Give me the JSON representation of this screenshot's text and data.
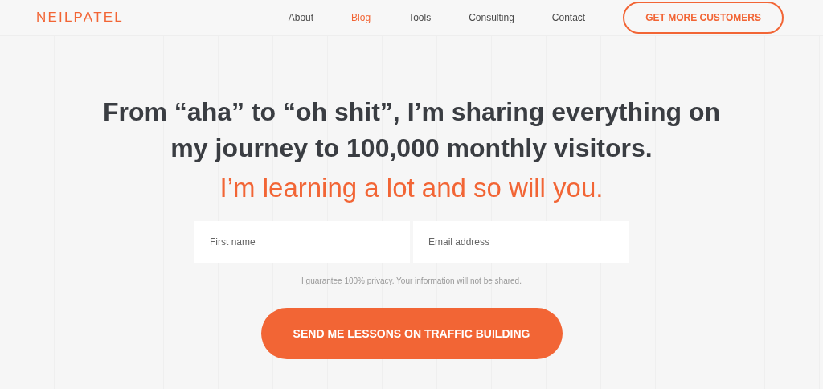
{
  "header": {
    "logo": "NEILPATEL",
    "nav": [
      {
        "label": "About",
        "selected": false
      },
      {
        "label": "Blog",
        "selected": true
      },
      {
        "label": "Tools",
        "selected": false
      },
      {
        "label": "Consulting",
        "selected": false
      },
      {
        "label": "Contact",
        "selected": false
      }
    ],
    "cta": "GET MORE CUSTOMERS"
  },
  "hero": {
    "headline": "From “aha” to “oh shit”, I’m sharing everything on my journey to 100,000 monthly visitors.",
    "subhead": "I’m learning a lot and so will you.",
    "fields": [
      {
        "placeholder": "First name"
      },
      {
        "placeholder": "Email address"
      }
    ],
    "privacy": "I guarantee 100% privacy. Your information will not be shared.",
    "submit": "SEND ME LESSONS ON TRAFFIC BUILDING"
  }
}
